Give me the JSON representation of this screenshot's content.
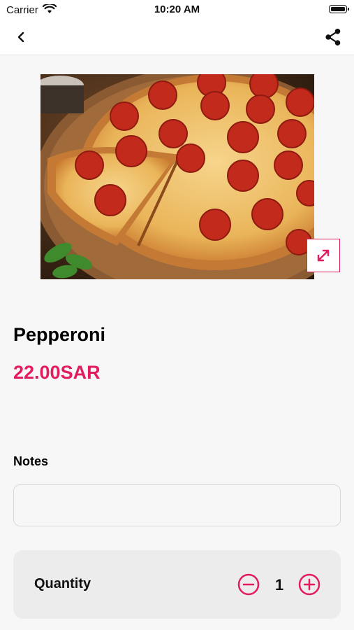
{
  "status_bar": {
    "carrier": "Carrier",
    "time": "10:20 AM"
  },
  "nav": {
    "back_icon": "chevron-left-icon",
    "share_icon": "share-icon"
  },
  "product": {
    "image_description_icon": "pizza-image",
    "name": "Pepperoni",
    "price": "22.00SAR",
    "expand_icon": "expand-icon"
  },
  "notes": {
    "label": "Notes",
    "value": "",
    "placeholder": ""
  },
  "quantity": {
    "label": "Quantity",
    "value": "1",
    "minus_icon": "minus-circle-icon",
    "plus_icon": "plus-circle-icon"
  },
  "colors": {
    "accent": "#e31c5f",
    "background": "#f7f7f7",
    "card": "#ececec"
  }
}
